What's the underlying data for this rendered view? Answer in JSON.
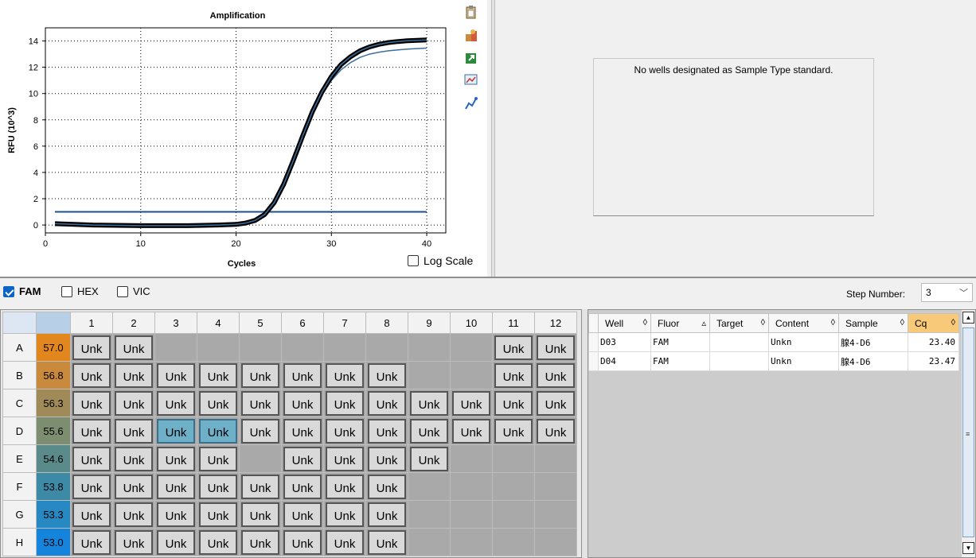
{
  "chart": {
    "title": "Amplification",
    "xlabel": "Cycles",
    "ylabel": "RFU (10^3)",
    "log_scale_label": "Log Scale",
    "log_scale_checked": false
  },
  "chart_data": {
    "type": "line",
    "title": "Amplification",
    "xlabel": "Cycles",
    "ylabel": "RFU (10^3)",
    "xlim": [
      0,
      42
    ],
    "ylim": [
      -0.6,
      15
    ],
    "xticks": [
      0,
      10,
      20,
      30,
      40
    ],
    "yticks": [
      0,
      2,
      4,
      6,
      8,
      10,
      12,
      14
    ],
    "grid": true,
    "threshold": 1.0,
    "series": [
      {
        "x": [
          1,
          5,
          10,
          15,
          18,
          20,
          21,
          22,
          23,
          24,
          25,
          26,
          27,
          28,
          29,
          30,
          31,
          32,
          33,
          34,
          35,
          36,
          37,
          38,
          39,
          40
        ],
        "y": [
          0.1,
          0.0,
          -0.05,
          -0.05,
          0.0,
          0.05,
          0.15,
          0.35,
          0.8,
          1.7,
          3.1,
          4.9,
          6.8,
          8.6,
          10.1,
          11.3,
          12.2,
          12.8,
          13.25,
          13.55,
          13.75,
          13.88,
          13.96,
          14.02,
          14.05,
          14.08
        ]
      },
      {
        "x": [
          1,
          5,
          10,
          15,
          18,
          20,
          21,
          22,
          23,
          24,
          25,
          26,
          27,
          28,
          29,
          30,
          31,
          32,
          33,
          34,
          35,
          36,
          37,
          38,
          39,
          40
        ],
        "y": [
          0.0,
          -0.05,
          -0.1,
          -0.1,
          -0.05,
          0.0,
          0.1,
          0.3,
          0.75,
          1.6,
          3.0,
          4.8,
          6.6,
          8.4,
          9.9,
          11.0,
          11.8,
          12.35,
          12.75,
          13.0,
          13.15,
          13.25,
          13.32,
          13.38,
          13.42,
          13.46
        ]
      }
    ]
  },
  "std_curve": {
    "message": "No wells designated as Sample Type standard."
  },
  "fluors": [
    {
      "label": "FAM",
      "checked": true
    },
    {
      "label": "HEX",
      "checked": false
    },
    {
      "label": "VIC",
      "checked": false
    }
  ],
  "step": {
    "label": "Step Number:",
    "value": "3"
  },
  "plate": {
    "columns": [
      "1",
      "2",
      "3",
      "4",
      "5",
      "6",
      "7",
      "8",
      "9",
      "10",
      "11",
      "12"
    ],
    "rows": [
      {
        "label": "A",
        "temp": "57.0",
        "color": "#e2871d",
        "wells": [
          "Unk",
          "Unk",
          "",
          "",
          "",
          "",
          "",
          "",
          "",
          "",
          "Unk",
          "Unk"
        ]
      },
      {
        "label": "B",
        "temp": "56.8",
        "color": "#c98a3b",
        "wells": [
          "Unk",
          "Unk",
          "Unk",
          "Unk",
          "Unk",
          "Unk",
          "Unk",
          "Unk",
          "",
          "",
          "Unk",
          "Unk"
        ]
      },
      {
        "label": "C",
        "temp": "56.3",
        "color": "#a08a58",
        "wells": [
          "Unk",
          "Unk",
          "Unk",
          "Unk",
          "Unk",
          "Unk",
          "Unk",
          "Unk",
          "Unk",
          "Unk",
          "Unk",
          "Unk"
        ]
      },
      {
        "label": "D",
        "temp": "55.6",
        "color": "#7d8d6f",
        "wells": [
          "Unk",
          "Unk",
          "Unk",
          "Unk",
          "Unk",
          "Unk",
          "Unk",
          "Unk",
          "Unk",
          "Unk",
          "Unk",
          "Unk"
        ]
      },
      {
        "label": "E",
        "temp": "54.6",
        "color": "#5a8a89",
        "wells": [
          "Unk",
          "Unk",
          "Unk",
          "Unk",
          "",
          "Unk",
          "Unk",
          "Unk",
          "Unk",
          "",
          "",
          ""
        ]
      },
      {
        "label": "F",
        "temp": "53.8",
        "color": "#3d8aa6",
        "wells": [
          "Unk",
          "Unk",
          "Unk",
          "Unk",
          "Unk",
          "Unk",
          "Unk",
          "Unk",
          "",
          "",
          "",
          ""
        ]
      },
      {
        "label": "G",
        "temp": "53.3",
        "color": "#2888c2",
        "wells": [
          "Unk",
          "Unk",
          "Unk",
          "Unk",
          "Unk",
          "Unk",
          "Unk",
          "Unk",
          "",
          "",
          "",
          ""
        ]
      },
      {
        "label": "H",
        "temp": "53.0",
        "color": "#1584dc",
        "wells": [
          "Unk",
          "Unk",
          "Unk",
          "Unk",
          "Unk",
          "Unk",
          "Unk",
          "Unk",
          "",
          "",
          "",
          ""
        ]
      }
    ],
    "selected": [
      "D3",
      "D4"
    ]
  },
  "results": {
    "headers": [
      {
        "label": "Well",
        "sort": "◊"
      },
      {
        "label": "Fluor",
        "sort": "▵"
      },
      {
        "label": "Target",
        "sort": "◊"
      },
      {
        "label": "Content",
        "sort": "◊"
      },
      {
        "label": "Sample",
        "sort": "◊"
      },
      {
        "label": "Cq",
        "sort": "◊"
      }
    ],
    "rows": [
      {
        "well": "D03",
        "fluor": "FAM",
        "target": "",
        "content": "Unkn",
        "sample": "腺4-D6",
        "cq": "23.40"
      },
      {
        "well": "D04",
        "fluor": "FAM",
        "target": "",
        "content": "Unkn",
        "sample": "腺4-D6",
        "cq": "23.47"
      }
    ]
  },
  "colors": {
    "curve_main": "#000000",
    "curve_highlight": "#3d6f9a",
    "threshold": "#1f4e8c",
    "selected_well": "#6fb0c9",
    "cq_header": "#f9c97a"
  },
  "toolbar_icons": [
    "copy-icon",
    "paste-special-icon",
    "export-icon",
    "image-export-icon",
    "trace-styles-icon"
  ]
}
